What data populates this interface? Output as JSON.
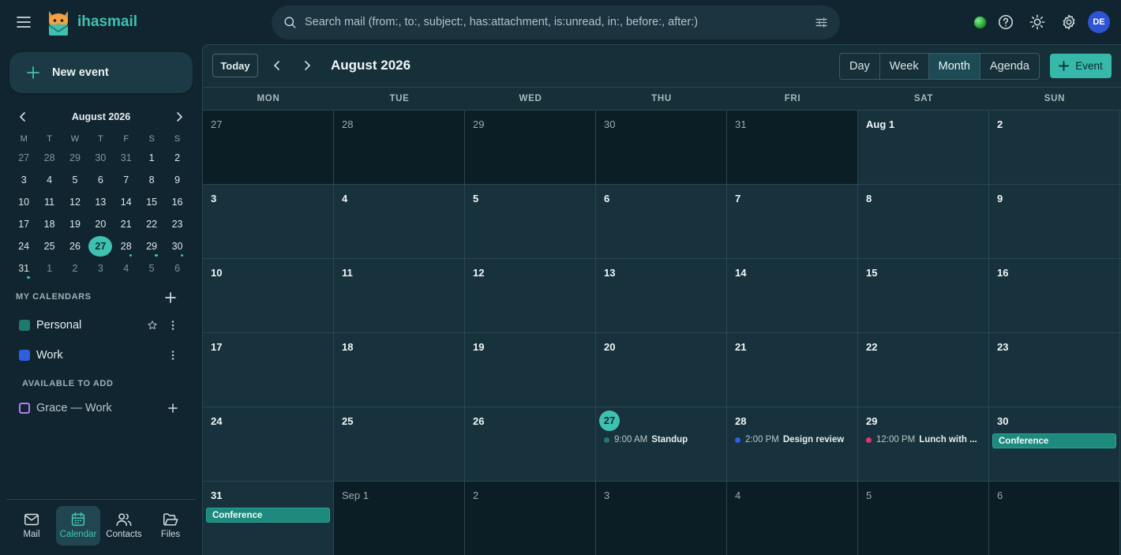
{
  "app": {
    "name": "ihasmail"
  },
  "search": {
    "placeholder": "Search mail  (from:, to:, subject:, has:attachment, is:unread, in:, before:, after:)"
  },
  "user": {
    "initials": "DE"
  },
  "colors": {
    "accent": "#3fc1b1",
    "personal": "#1f7a6c",
    "work": "#2f5fe0",
    "grace": "#b47cf0",
    "pink": "#e0336f"
  },
  "sidebar": {
    "new_event_label": "New event",
    "mini_calendar": {
      "title": "August 2026",
      "weekdays": [
        "M",
        "T",
        "W",
        "T",
        "F",
        "S",
        "S"
      ],
      "weeks": [
        [
          {
            "d": "27",
            "o": true
          },
          {
            "d": "28",
            "o": true
          },
          {
            "d": "29",
            "o": true
          },
          {
            "d": "30",
            "o": true
          },
          {
            "d": "31",
            "o": true
          },
          {
            "d": "1"
          },
          {
            "d": "2"
          }
        ],
        [
          {
            "d": "3"
          },
          {
            "d": "4"
          },
          {
            "d": "5"
          },
          {
            "d": "6"
          },
          {
            "d": "7"
          },
          {
            "d": "8"
          },
          {
            "d": "9"
          }
        ],
        [
          {
            "d": "10"
          },
          {
            "d": "11"
          },
          {
            "d": "12"
          },
          {
            "d": "13"
          },
          {
            "d": "14"
          },
          {
            "d": "15"
          },
          {
            "d": "16"
          }
        ],
        [
          {
            "d": "17"
          },
          {
            "d": "18"
          },
          {
            "d": "19"
          },
          {
            "d": "20"
          },
          {
            "d": "21"
          },
          {
            "d": "22"
          },
          {
            "d": "23"
          }
        ],
        [
          {
            "d": "24"
          },
          {
            "d": "25"
          },
          {
            "d": "26"
          },
          {
            "d": "27",
            "today": true
          },
          {
            "d": "28",
            "dot": true
          },
          {
            "d": "29",
            "dot": true
          },
          {
            "d": "30",
            "dot": true
          }
        ],
        [
          {
            "d": "31",
            "dot": true
          },
          {
            "d": "1",
            "o": true
          },
          {
            "d": "2",
            "o": true
          },
          {
            "d": "3",
            "o": true
          },
          {
            "d": "4",
            "o": true
          },
          {
            "d": "5",
            "o": true
          },
          {
            "d": "6",
            "o": true
          }
        ]
      ]
    },
    "my_calendars_title": "MY CALENDARS",
    "calendars": [
      {
        "name": "Personal",
        "starred": true
      },
      {
        "name": "Work",
        "starred": false
      }
    ],
    "available_title": "AVAILABLE TO ADD",
    "available": [
      {
        "name": "Grace — Work"
      }
    ],
    "nav": [
      {
        "label": "Mail",
        "icon": "mail-icon"
      },
      {
        "label": "Calendar",
        "icon": "calendar-icon",
        "active": true
      },
      {
        "label": "Contacts",
        "icon": "contacts-icon"
      },
      {
        "label": "Files",
        "icon": "folder-icon"
      }
    ]
  },
  "toolbar": {
    "today_label": "Today",
    "title": "August 2026",
    "views": [
      "Day",
      "Week",
      "Month",
      "Agenda"
    ],
    "active_view": "Month",
    "event_button_label": "Event"
  },
  "month": {
    "weekdays": [
      "MON",
      "TUE",
      "WED",
      "THU",
      "FRI",
      "SAT",
      "SUN"
    ],
    "weeks": [
      [
        {
          "d": "27",
          "o": true
        },
        {
          "d": "28",
          "o": true
        },
        {
          "d": "29",
          "o": true
        },
        {
          "d": "30",
          "o": true
        },
        {
          "d": "31",
          "o": true
        },
        {
          "d": "Aug 1"
        },
        {
          "d": "2"
        }
      ],
      [
        {
          "d": "3"
        },
        {
          "d": "4"
        },
        {
          "d": "5"
        },
        {
          "d": "6"
        },
        {
          "d": "7"
        },
        {
          "d": "8"
        },
        {
          "d": "9"
        }
      ],
      [
        {
          "d": "10"
        },
        {
          "d": "11"
        },
        {
          "d": "12"
        },
        {
          "d": "13"
        },
        {
          "d": "14"
        },
        {
          "d": "15"
        },
        {
          "d": "16"
        }
      ],
      [
        {
          "d": "17"
        },
        {
          "d": "18"
        },
        {
          "d": "19"
        },
        {
          "d": "20"
        },
        {
          "d": "21"
        },
        {
          "d": "22"
        },
        {
          "d": "23"
        }
      ],
      [
        {
          "d": "24"
        },
        {
          "d": "25"
        },
        {
          "d": "26"
        },
        {
          "d": "27",
          "today": true,
          "events": [
            {
              "time": "9:00 AM",
              "title": "Standup",
              "color": "#1f7a6c"
            }
          ]
        },
        {
          "d": "28",
          "events": [
            {
              "time": "2:00 PM",
              "title": "Design review",
              "color": "#2f5fe0"
            }
          ]
        },
        {
          "d": "29",
          "events": [
            {
              "time": "12:00 PM",
              "title": "Lunch with ...",
              "color": "#e0336f"
            }
          ]
        },
        {
          "d": "30",
          "allday": "Conference"
        }
      ],
      [
        {
          "d": "31",
          "allday": "Conference"
        },
        {
          "d": "Sep 1",
          "o": true
        },
        {
          "d": "2",
          "o": true
        },
        {
          "d": "3",
          "o": true
        },
        {
          "d": "4",
          "o": true
        },
        {
          "d": "5",
          "o": true
        },
        {
          "d": "6",
          "o": true
        }
      ]
    ]
  }
}
